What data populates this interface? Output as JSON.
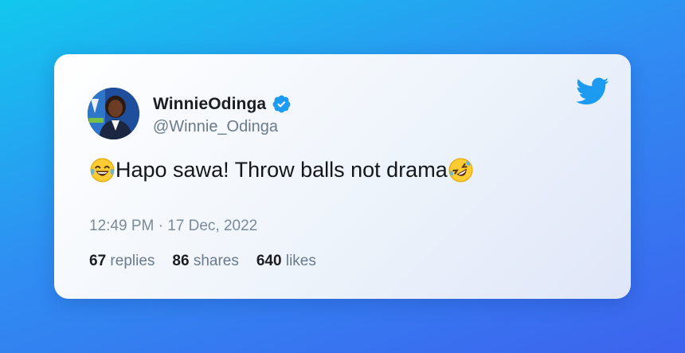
{
  "colors": {
    "accent": "#1d9bf0",
    "text": "#14171a",
    "muted": "#697a8a"
  },
  "tweet": {
    "display_name": "WinnieOdinga",
    "handle": "@Winnie_Odinga",
    "verified_icon": "verified-badge-icon",
    "brand_icon": "twitter-bird-icon",
    "avatar_icon": "profile-photo",
    "text": "Hapo sawa! Throw balls not drama",
    "leading_emoji": "face-with-tears-of-joy",
    "trailing_emoji": "rolling-on-the-floor-laughing",
    "timestamp": "12:49 PM · 17 Dec, 2022",
    "stats": {
      "replies_count": "67",
      "replies_label": "replies",
      "shares_count": "86",
      "shares_label": "shares",
      "likes_count": "640",
      "likes_label": "likes"
    }
  }
}
